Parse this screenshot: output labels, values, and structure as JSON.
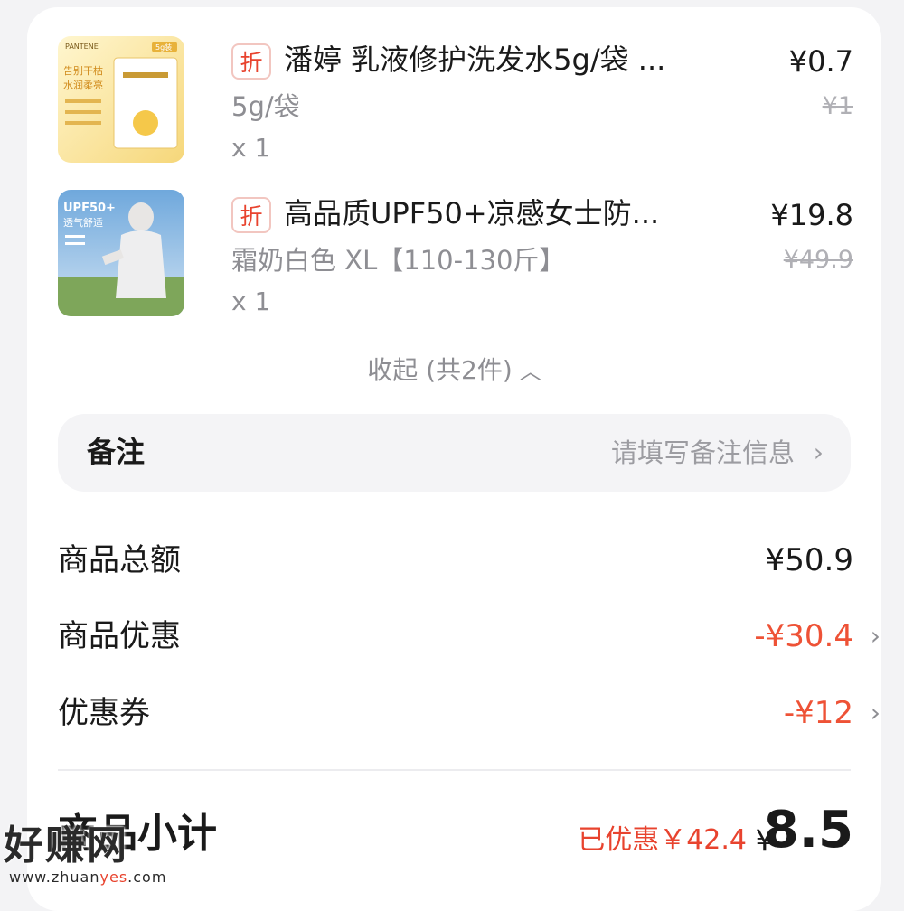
{
  "products": [
    {
      "badge": "折",
      "title": "潘婷 乳液修护洗发水5g/袋 ...",
      "spec": "5g/袋",
      "qty": "x 1",
      "price": "¥0.7",
      "original_price": "¥1",
      "thumb_texts": [
        "PANTENE",
        "5g装",
        "告别干枯",
        "水润柔亮"
      ]
    },
    {
      "badge": "折",
      "title": "高品质UPF50+凉感女士防...",
      "spec": "霜奶白色 XL【110-130斤】",
      "qty": "x 1",
      "price": "¥19.8",
      "original_price": "¥49.9",
      "thumb_texts": [
        "UPF50+",
        "透气舒适"
      ]
    }
  ],
  "collapse_label": "收起 (共2件)",
  "remark": {
    "label": "备注",
    "placeholder": "请填写备注信息"
  },
  "summary": {
    "goods_total_label": "商品总额",
    "goods_total_value": "¥50.9",
    "goods_discount_label": "商品优惠",
    "goods_discount_value": "-¥30.4",
    "coupon_label": "优惠券",
    "coupon_value": "-¥12"
  },
  "subtotal": {
    "label": "商品小计",
    "saved_text": "已优惠￥42.4",
    "currency": "¥",
    "amount": "8.5"
  },
  "watermark": {
    "main": "好赚网",
    "site_prefix": "www.zhuan",
    "site_highlight": "yes",
    "site_suffix": ".com"
  },
  "colors": {
    "accent_red": "#ee5236",
    "muted_text": "#8e8e93",
    "panel_bg": "#f4f4f6"
  }
}
